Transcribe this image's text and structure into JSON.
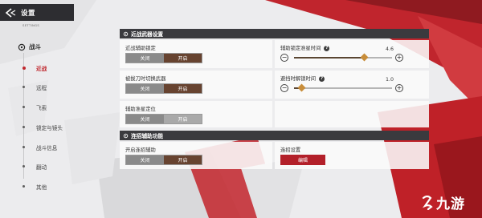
{
  "header": {
    "title": "设置",
    "subtitle": "SETTINGS"
  },
  "sidebar": {
    "category": "战斗",
    "items": [
      {
        "label": "近战",
        "active": true
      },
      {
        "label": "远程",
        "active": false
      },
      {
        "label": "飞索",
        "active": false
      },
      {
        "label": "锁定与镜头",
        "active": false
      },
      {
        "label": "战斗信息",
        "active": false
      },
      {
        "label": "翻动",
        "active": false
      },
      {
        "label": "其他",
        "active": false
      }
    ]
  },
  "melee_section": {
    "title": "近战武器设置",
    "assist_lock": {
      "label": "近战辅助锁定",
      "off": "关闭",
      "on": "开启",
      "value": "开启"
    },
    "auto_switch": {
      "label": "被拔刀时切换武器",
      "off": "关闭",
      "on": "开启",
      "value": "开启"
    },
    "assist_aim": {
      "label": "辅助准星定位",
      "off": "关闭",
      "on": "开启",
      "value": "关闭"
    },
    "lock_aim_time": {
      "label": "辅助锁定准星时间",
      "value": "4.6",
      "fraction": 0.72,
      "minus": "−",
      "plus": "+"
    },
    "dodge_unlock_time": {
      "label": "避挡时解锁时间",
      "value": "1.0",
      "fraction": 0.08,
      "minus": "−",
      "plus": "+"
    }
  },
  "combo_section": {
    "title": "连招辅助功能",
    "enable_combo": {
      "label": "开启连招辅助",
      "off": "关闭",
      "on": "开启",
      "value": "开启"
    },
    "combo_settings": {
      "label": "连招设置",
      "button": "编辑"
    }
  },
  "watermark": {
    "text": "九游"
  },
  "colors": {
    "accent_red": "#c0272d",
    "on_brown": "#674330",
    "header_dark": "#3a3a3e",
    "slider_gold": "#c88d3a"
  }
}
